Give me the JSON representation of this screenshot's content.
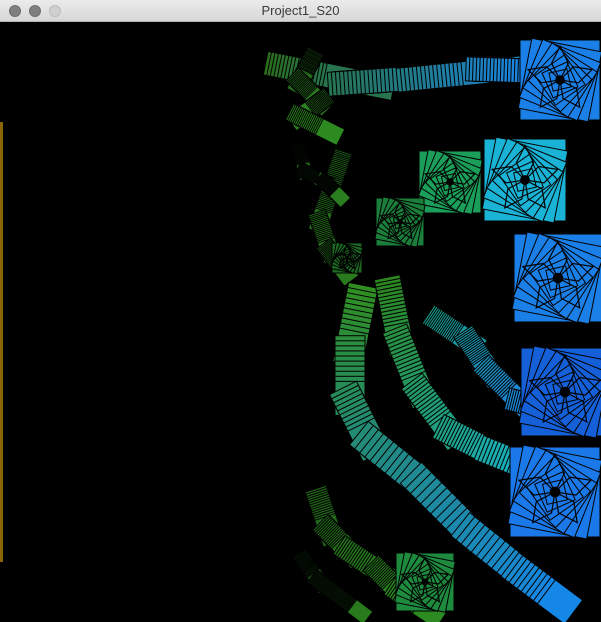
{
  "window": {
    "title": "Project1_S20"
  },
  "canvas": {
    "background": "#000000",
    "palette": {
      "dark_green": "#1a5c1a",
      "green": "#2e8b2e",
      "teal": "#18a68c",
      "cyan": "#19b5c9",
      "blue": "#1a7fe6",
      "deep_blue": "#1560d8"
    }
  }
}
